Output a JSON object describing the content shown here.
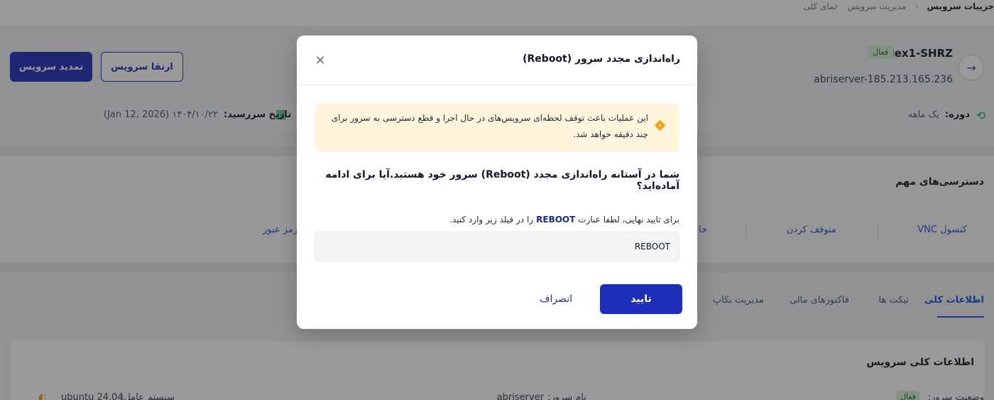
{
  "breadcrumb": {
    "items": [
      "جزییات سرویس",
      "مدیریت سرویس",
      "نمای کلی"
    ]
  },
  "service": {
    "name": "Flex1-SHRZ",
    "status": "فعال",
    "hostname": "abriserver-185.213.165.236",
    "renew_label": "تمدید سرویس",
    "upgrade_label": "ارتقا سرویس",
    "period_label": "دوره:",
    "period_value": "یک ماهه",
    "expiry_label": "تاریخ سررسید:",
    "expiry_value": "۱۴۰۴/۱۰/۲۲ (Jan 12, 2026)"
  },
  "access": {
    "title": "دسترسی‌های مهم",
    "links": [
      "کنسول VNC",
      "متوقف کردن",
      "حا",
      "ر رمز عبور"
    ]
  },
  "tabs": [
    "اطلاعات کلی",
    "تیکت ها",
    "فاکتورهای مالی",
    "مدیریت بکاپ"
  ],
  "info": {
    "title": "اطلاعات کلی سرویس",
    "status_label": "وضعیت سرور:",
    "status_value": "فعال",
    "host_label": "نام سرور:",
    "host_value": "abriserver",
    "os_label": "سیستم عامل:",
    "os_value": "ubuntu 24.04"
  },
  "modal": {
    "title": "راه‌اندازی مجدد سرور (Reboot)",
    "warning": "این عملیات باعث توقف لحظه‌ای سرویس‌های در حال اجرا و قطع دسترسی به سرور برای چند دقیقه خواهد شد.",
    "question": "شما در آستانه راه‌اندازی مجدد (Reboot) سرور خود هستید.آیا برای ادامه آماده‌اید؟",
    "hint_before": "برای تایید نهایی، لطفا عبارت",
    "hint_keyword": "REBOOT",
    "hint_after": "را در فیلد زیر وارد کنید.",
    "input_value": "REBOOT",
    "confirm_label": "تایید",
    "cancel_label": "انصراف"
  }
}
